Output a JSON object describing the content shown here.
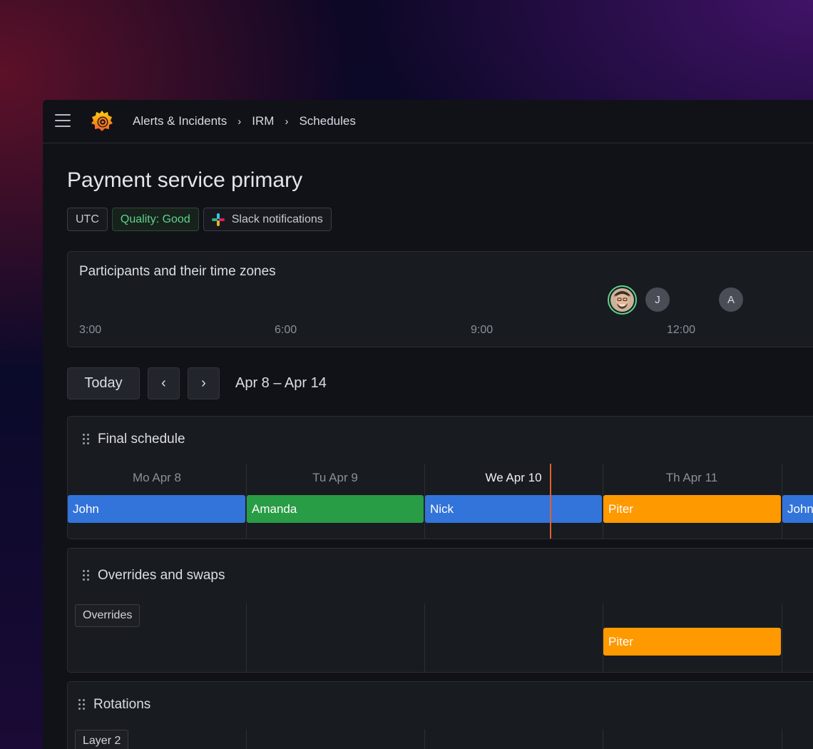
{
  "breadcrumb": {
    "items": [
      "Alerts & Incidents",
      "IRM",
      "Schedules"
    ],
    "separator": "›"
  },
  "page": {
    "title": "Payment service primary",
    "tags": {
      "timezone": "UTC",
      "quality": "Quality: Good",
      "slack": "Slack notifications"
    }
  },
  "participants": {
    "title": "Participants and their time zones",
    "times": [
      "3:00",
      "6:00",
      "9:00",
      "12:00"
    ],
    "avatars": [
      {
        "initial": "J"
      },
      {
        "initial": "A"
      }
    ]
  },
  "nav": {
    "today": "Today",
    "prev": "‹",
    "next": "›",
    "range": "Apr 8 – Apr 14"
  },
  "final_schedule": {
    "title": "Final schedule",
    "days": [
      "Mo Apr 8",
      "Tu Apr 9",
      "We Apr 10",
      "Th Apr 11"
    ],
    "today_index": 2,
    "shifts": [
      {
        "name": "John",
        "color": "#3274d9"
      },
      {
        "name": "Amanda",
        "color": "#299c46"
      },
      {
        "name": "Nick",
        "color": "#3274d9"
      },
      {
        "name": "Piter",
        "color": "#ff9900"
      },
      {
        "name": "John",
        "color": "#3274d9"
      }
    ]
  },
  "overrides": {
    "title": "Overrides and swaps",
    "label": "Overrides",
    "shift": {
      "name": "Piter",
      "color": "#ff9900"
    }
  },
  "rotations": {
    "title": "Rotations",
    "layer_label": "Layer 2"
  },
  "colors": {
    "now_line": "#e0602d",
    "quality_good": "#5ed38b"
  }
}
